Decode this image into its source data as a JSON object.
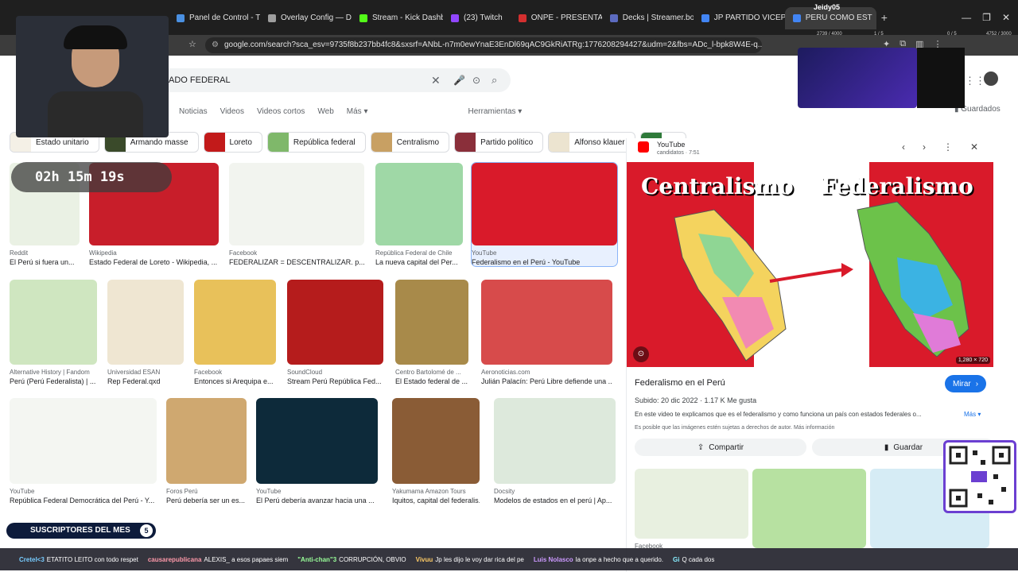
{
  "browser": {
    "tabs": [
      {
        "title": "Panel de Control - Tim",
        "color": "#4a90e2"
      },
      {
        "title": "Overlay Config — Dat",
        "color": "#9e9e9e"
      },
      {
        "title": "Stream - Kick Dashbo",
        "color": "#53fc18"
      },
      {
        "title": "(23) Twitch",
        "color": "#9146ff"
      },
      {
        "title": "ONPE - PRESENTACIÓ",
        "color": "#d32f2f"
      },
      {
        "title": "Decks | Streamer.bot",
        "color": "#5c6bc0"
      },
      {
        "title": "JP PARTIDO VICEPRES",
        "color": "#4285f4"
      },
      {
        "title": "PERU COMO EST",
        "color": "#4285f4"
      }
    ],
    "url": "google.com/search?sca_esv=9735f8b237bb4fc8&sxsrf=ANbL-n7m0ewYnaE3EnDl69qAC9GkRiATRg:1776208294427&udm=2&fbs=ADc_l-bpk8W4E-q..."
  },
  "search": {
    "query": "ADO FEDERAL",
    "tabs": [
      "Noticias",
      "Videos",
      "Videos cortos",
      "Web",
      "Más",
      "Herramientas"
    ],
    "saved_label": "Guardados"
  },
  "chips": [
    "Estado unitario",
    "Armando masse",
    "Loreto",
    "República federal",
    "Centralismo",
    "Partido político",
    "Alfonso klauer",
    "Pa"
  ],
  "results": [
    {
      "source": "Reddit",
      "title": "El Perú si fuera un..."
    },
    {
      "source": "Wikipedia",
      "title": "Estado Federal de Loreto - Wikipedia, ..."
    },
    {
      "source": "Facebook",
      "title": "FEDERALIZAR = DESCENTRALIZAR. p..."
    },
    {
      "source": "República Federal de Chile",
      "title": "La nueva capital del Per..."
    },
    {
      "source": "YouTube",
      "title": "Federalismo en el Perú - YouTube"
    },
    {
      "source": "Alternative History | Fandom",
      "title": "Perú (Perú Federalista) | ..."
    },
    {
      "source": "Universidad ESAN",
      "title": "Rep Federal.qxd"
    },
    {
      "source": "Facebook",
      "title": "Entonces si Arequipa e..."
    },
    {
      "source": "SoundCloud",
      "title": "Stream Perú República Fed..."
    },
    {
      "source": "Centro Bartolomé de ...",
      "title": "El Estado federal de ..."
    },
    {
      "source": "Aeronoticias.com",
      "title": "Julián Palacín: Perú Libre defiende una ..."
    },
    {
      "source": "YouTube",
      "title": "República Federal Democrática del Perú - Y..."
    },
    {
      "source": "Foros Perú",
      "title": "Perú debería ser un es..."
    },
    {
      "source": "YouTube",
      "title": "El Perú debería avanzar hacia una ..."
    },
    {
      "source": "Yakumama Amazon Tours",
      "title": "Iquitos, capital del federalis..."
    },
    {
      "source": "Docsity",
      "title": "Modelos de estados en el perú | Ap..."
    }
  ],
  "panel": {
    "source": "YouTube",
    "channel": "candidatos · 7:51",
    "title": "Federalismo en el Perú",
    "meta": "Subido: 20 dic 2022 · 1.17 K Me gusta",
    "description": "En este video te explicamos que es el federalismo y como funciona un país con estados federales o...",
    "more": "Más",
    "rights": "Es posible que las imágenes estén sujetas a derechos de autor. Más información",
    "watch": "Mirar",
    "share": "Compartir",
    "save": "Guardar",
    "dimensions": "1,280 × 720",
    "image_text_left": "Centralismo",
    "image_text_right": "Federalismo",
    "related_source": "Facebook"
  },
  "stream": {
    "timer": "02h 15m 19s",
    "subs_label": "SUSCRIPTORES DEL MES",
    "subs_count": "5",
    "user": "Jeidy05",
    "stat1": "2739 / 4000",
    "stat2": "1 / 5",
    "stat3": "0 / 5",
    "stat4": "4752 / 3000"
  },
  "chat": [
    {
      "user": "Cretel<3",
      "msg": "ETATITO LEITO con todo respet"
    },
    {
      "user": "causarepublicana",
      "msg": "ALEXIS_ a esos papaes siem"
    },
    {
      "user": "\"Anti-chan\"3",
      "msg": "CORRUPCIÓN, OBVIO"
    },
    {
      "user": "Vivuu",
      "msg": "Jp les dijo le voy dar rica del pe"
    },
    {
      "user": "Luis Nolasco",
      "msg": "la onpe a hecho que a querido."
    },
    {
      "user": "Gi",
      "msg": "Q cada dos"
    }
  ]
}
